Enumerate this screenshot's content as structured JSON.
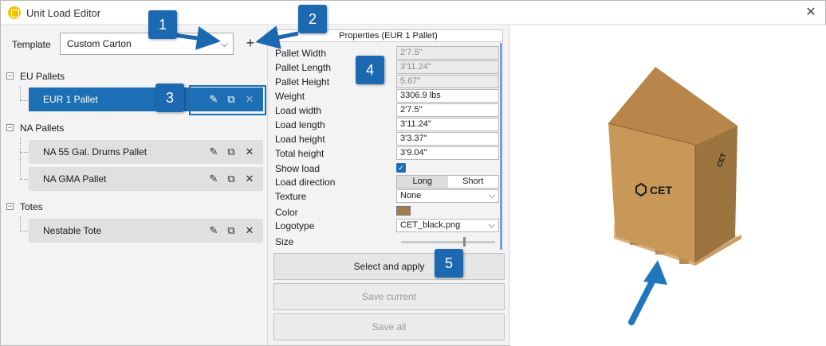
{
  "window": {
    "title": "Unit Load Editor",
    "close_glyph": "✕"
  },
  "template": {
    "label": "Template",
    "value": "Custom Carton",
    "add_glyph": "+"
  },
  "groups": [
    {
      "label": "EU Pallets",
      "items": [
        {
          "label": "EUR 1 Pallet",
          "selected": true
        }
      ]
    },
    {
      "label": "NA Pallets",
      "items": [
        {
          "label": "NA 55 Gal. Drums Pallet"
        },
        {
          "label": "NA GMA Pallet"
        }
      ]
    },
    {
      "label": "Totes",
      "items": [
        {
          "label": "Nestable Tote"
        }
      ]
    }
  ],
  "icons": {
    "edit": "edit-icon",
    "duplicate": "duplicate-icon",
    "delete": "delete-icon"
  },
  "properties": {
    "header": "Properties (EUR 1 Pallet)",
    "pallet_width": {
      "label": "Pallet Width",
      "value": "2'7.5\""
    },
    "pallet_length": {
      "label": "Pallet Length",
      "value": "3'11.24\""
    },
    "pallet_height": {
      "label": "Pallet Height",
      "value": "5.67\""
    },
    "weight": {
      "label": "Weight",
      "value": "3306.9 lbs"
    },
    "load_width": {
      "label": "Load width",
      "value": "2'7.5\""
    },
    "load_length": {
      "label": "Load length",
      "value": "3'11.24\""
    },
    "load_height": {
      "label": "Load height",
      "value": "3'3.37\""
    },
    "total_height": {
      "label": "Total height",
      "value": "3'9.04\""
    },
    "show_load": {
      "label": "Show load",
      "checked": true
    },
    "load_direction": {
      "label": "Load direction",
      "options": [
        "Long",
        "Short"
      ],
      "selected": "Long"
    },
    "texture": {
      "label": "Texture",
      "value": "None"
    },
    "color": {
      "label": "Color",
      "value": "#a07d4e"
    },
    "logotype": {
      "label": "Logotype",
      "value": "CET_black.png"
    },
    "size": {
      "label": "Size",
      "level": 0.66
    }
  },
  "buttons": {
    "apply": "Select and apply",
    "save_current": "Save current",
    "save_all": "Save all"
  },
  "preview": {
    "logo_text": "CET"
  },
  "callouts": [
    "1",
    "2",
    "3",
    "4",
    "5"
  ],
  "colors": {
    "accent": "#1d6fb5",
    "badge": "#1c68b1",
    "box": "#c89a5c",
    "pallet": "#e2bf90"
  }
}
